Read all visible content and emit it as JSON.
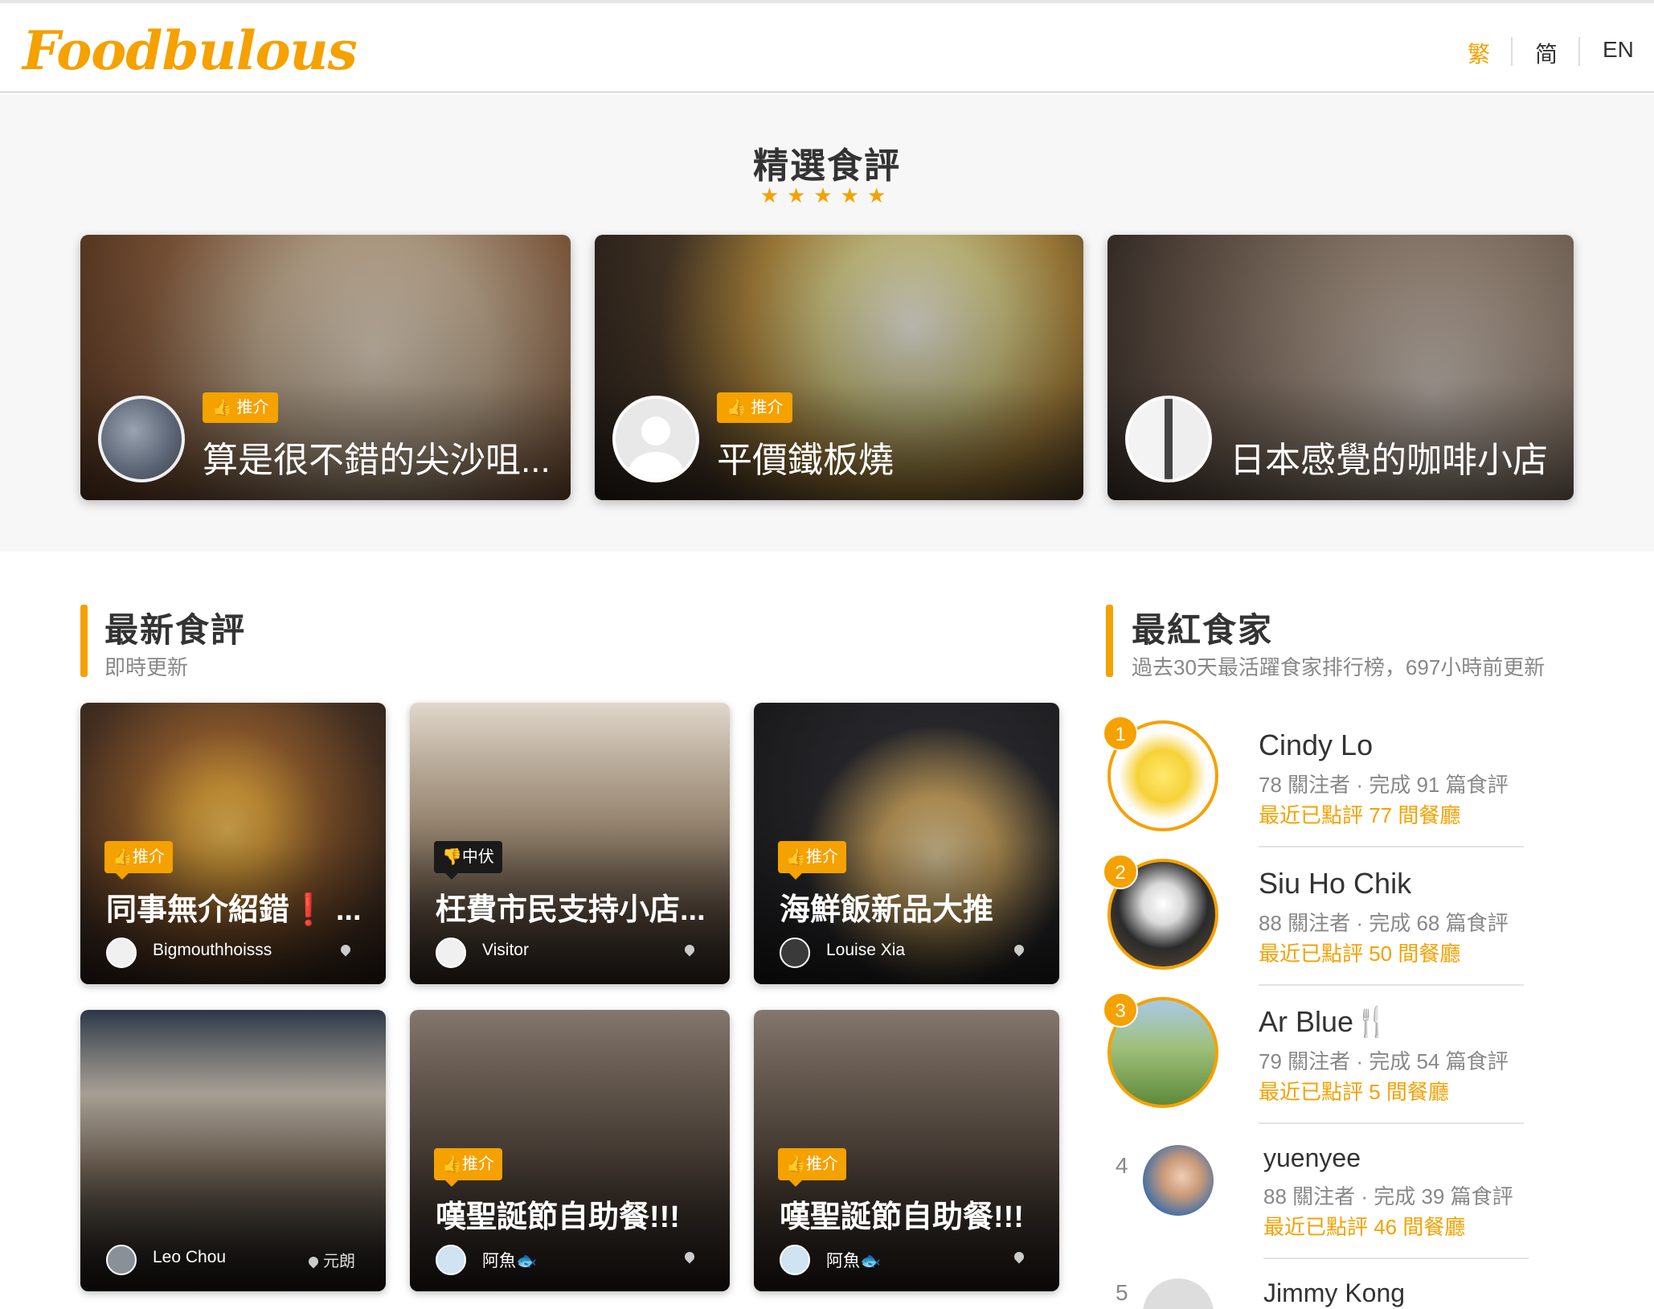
{
  "header": {
    "logo": "Foodbulous",
    "languages": [
      "繁",
      "简",
      "EN"
    ],
    "active_language": "繁"
  },
  "featured": {
    "title": "精選食評",
    "stars": "★★★★★",
    "cards": [
      {
        "tag": "推介",
        "title": "算是很不錯的尖沙咀..."
      },
      {
        "tag": "推介",
        "title": "平價鐵板燒"
      },
      {
        "tag": "",
        "title": "日本感覺的咖啡小店"
      }
    ]
  },
  "latest": {
    "title": "最新食評",
    "subtitle": "即時更新",
    "cards": [
      {
        "tag": "推介",
        "title": "同事無介紹錯❗ ...",
        "user": "Bigmouthhoisss",
        "location": ""
      },
      {
        "tag": "中伏",
        "title": "枉費市民支持小店...",
        "user": "Visitor",
        "location": ""
      },
      {
        "tag": "推介",
        "title": "海鮮飯新品大推",
        "user": "Louise Xia",
        "location": ""
      },
      {
        "tag": "",
        "title": "",
        "user": "Leo Chou",
        "location": "元朗"
      },
      {
        "tag": "推介",
        "title": "嘆聖誕節自助餐!!!",
        "user": "阿魚🐟",
        "location": ""
      },
      {
        "tag": "推介",
        "title": "嘆聖誕節自助餐!!!",
        "user": "阿魚🐟",
        "location": ""
      }
    ]
  },
  "top_foodies": {
    "title": "最紅食家",
    "subtitle": "過去30天最活躍食家排行榜，697小時前更新",
    "items": [
      {
        "rank": "1",
        "name": "Cindy Lo",
        "stat": "78 關注者 · 完成 91 篇食評",
        "recent": "最近已點評 77 間餐廳"
      },
      {
        "rank": "2",
        "name": "Siu Ho Chik",
        "stat": "88 關注者 · 完成 68 篇食評",
        "recent": "最近已點評 50 間餐廳"
      },
      {
        "rank": "3",
        "name": "Ar Blue🍴",
        "stat": "79 關注者 · 完成 54 篇食評",
        "recent": "最近已點評 5 間餐廳"
      },
      {
        "rank": "4",
        "name": "yuenyee",
        "stat": "88 關注者 · 完成 39 篇食評",
        "recent": "最近已點評 46 間餐廳"
      },
      {
        "rank": "5",
        "name": "Jimmy Kong",
        "stat": "",
        "recent": ""
      }
    ]
  },
  "colors": {
    "accent": "#f5a100",
    "text": "#333333",
    "muted": "#888888"
  }
}
